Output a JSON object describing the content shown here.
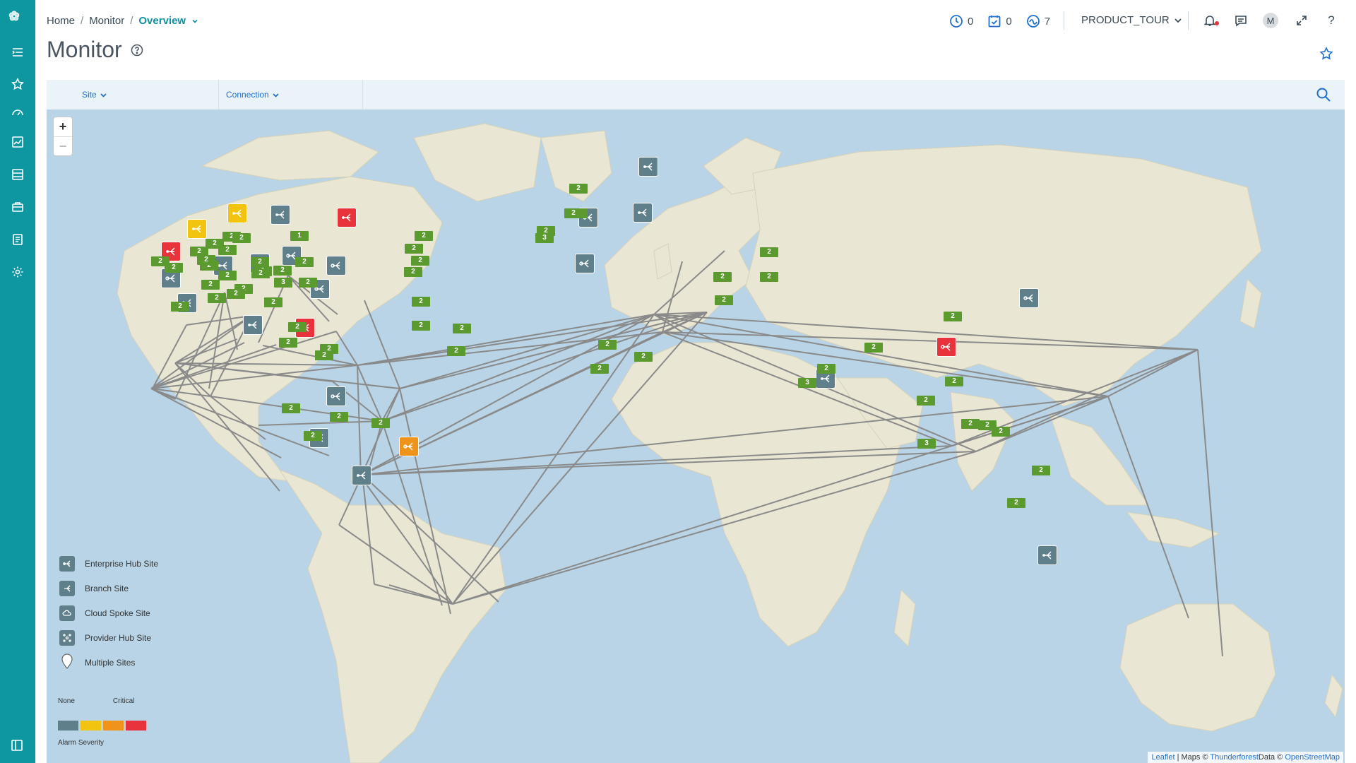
{
  "rail": {
    "items": [
      "menu-icon",
      "star-icon",
      "gauge-icon",
      "chart-icon",
      "server-icon",
      "briefcase-icon",
      "document-icon",
      "gear-icon"
    ]
  },
  "breadcrumb": {
    "home": "Home",
    "monitor": "Monitor",
    "current": "Overview"
  },
  "header": {
    "counter_clock": "0",
    "counter_calendar": "0",
    "counter_wave": "7",
    "tenant": "PRODUCT_TOUR",
    "avatar": "M",
    "help_label": "?"
  },
  "page": {
    "title": "Monitor"
  },
  "filters": {
    "site": "Site",
    "connection": "Connection"
  },
  "map": {
    "zoom_in": "+",
    "zoom_out": "−",
    "attribution": {
      "leaflet": "Leaflet",
      "maps": " | Maps © ",
      "thunderforest": "Thunderforest",
      "data": "Data © ",
      "osm": "OpenStreetMap"
    }
  },
  "legend": {
    "items": [
      {
        "label": "Enterprise Hub Site",
        "icon": "enterprise-hub-icon"
      },
      {
        "label": "Branch Site",
        "icon": "branch-icon"
      },
      {
        "label": "Cloud Spoke Site",
        "icon": "cloud-spoke-icon"
      },
      {
        "label": "Provider Hub Site",
        "icon": "provider-hub-icon"
      },
      {
        "label": "Multiple Sites",
        "icon": "pin-icon"
      }
    ],
    "severity_low": "None",
    "severity_high": "Critical",
    "severity_title": "Alarm Severity",
    "severity_colors": [
      "#5f7f8a",
      "#f2c40f",
      "#f0931a",
      "#e8323c"
    ]
  },
  "colors": {
    "accent": "#0e97a1",
    "link": "#1f6fd0",
    "edge_label": "#5b9a2e"
  },
  "connection_labels": [
    "2",
    "2",
    "1",
    "2",
    "2",
    "2",
    "2",
    "2",
    "2",
    "2",
    "2",
    "2",
    "2",
    "2",
    "2",
    "2",
    "2",
    "2",
    "2",
    "2",
    "3",
    "2",
    "2",
    "2",
    "2",
    "2",
    "2",
    "2",
    "2",
    "3",
    "2",
    "2",
    "2",
    "2",
    "2",
    "2",
    "2",
    "2",
    "2",
    "2",
    "2",
    "2",
    "2",
    "2",
    "2",
    "2",
    "2",
    "2",
    "2",
    "2",
    "2",
    "2",
    "3",
    "2",
    "2",
    "2",
    "2",
    "2",
    "3",
    "2",
    "2",
    "2",
    "2",
    "2"
  ]
}
